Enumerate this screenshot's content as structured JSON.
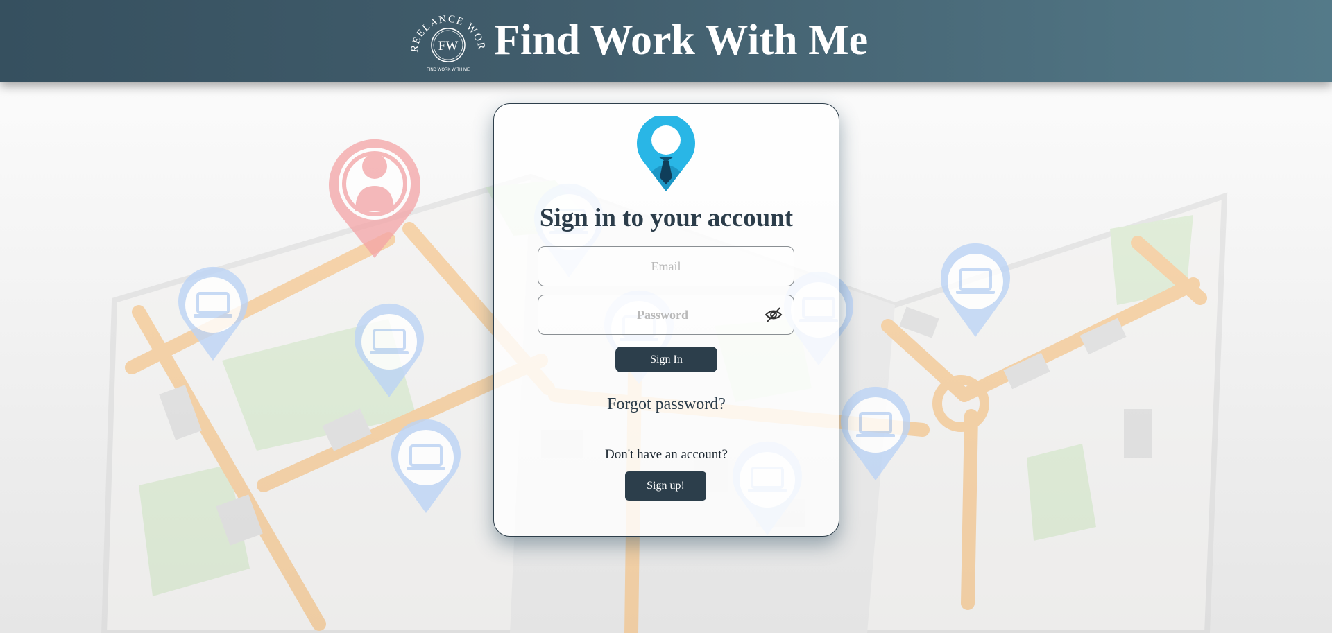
{
  "header": {
    "title": "Find Work With Me",
    "logo": {
      "arc_text": "FREELANCE WORK",
      "monogram": "FW",
      "tagline": "FIND WORK WITH ME"
    }
  },
  "login": {
    "heading": "Sign in to your account",
    "email_placeholder": "Email",
    "password_placeholder": "Password",
    "signin_label": "Sign In",
    "forgot_label": "Forgot password?",
    "no_account_text": "Don't have an account?",
    "signup_label": "Sign up!"
  },
  "icons": {
    "brand_pin": "job-location-pin-icon",
    "password_toggle": "eye-slash-icon",
    "map_user_pin": "user-pin-icon",
    "map_laptop_pins": "laptop-pin-icon"
  },
  "colors": {
    "header_dark": "#36505f",
    "header_light": "#547a89",
    "button": "#2c3e4b",
    "pin_blue": "#29b6e6",
    "map_road": "#f7c48a",
    "map_park": "#d7ebcc",
    "user_pin": "#f4a4a6",
    "laptop_pin": "#bcd4f5"
  }
}
